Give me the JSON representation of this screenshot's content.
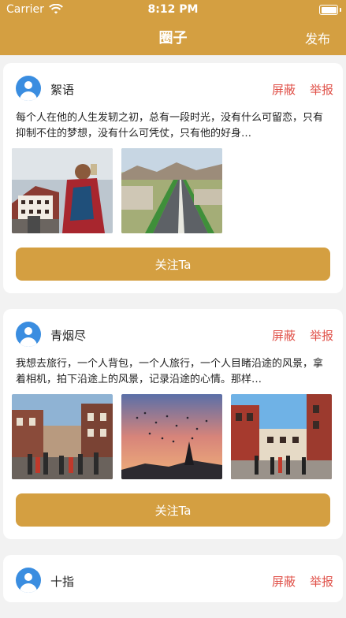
{
  "status": {
    "carrier": "Carrier",
    "time": "8:12 PM"
  },
  "nav": {
    "title": "圈子",
    "publish": "发布"
  },
  "actions": {
    "block": "屏蔽",
    "report": "举报",
    "follow": "关注Ta"
  },
  "posts": [
    {
      "username": "絮语",
      "text": "每个人在他的人生发轫之初，总有一段时光，没有什么可留恋，只有抑制不住的梦想，没有什么可凭仗，只有他的好身…",
      "photos": [
        "tibet-palace-performer-photo",
        "highway-landscape-photo"
      ]
    },
    {
      "username": "青烟尽",
      "text": "我想去旅行，一个人背包，一个人旅行，一个人目睹沿途的风景，拿着相机，拍下沿途上的风景，记录沿途的心情。那样…",
      "photos": [
        "street-crowd-photo",
        "sunset-birds-photo",
        "street-buildings-photo"
      ]
    },
    {
      "username": "十指",
      "text": "",
      "photos": []
    }
  ],
  "colors": {
    "brand": "#d49f41",
    "danger": "#e0524a",
    "avatar": "#3a8de0"
  }
}
